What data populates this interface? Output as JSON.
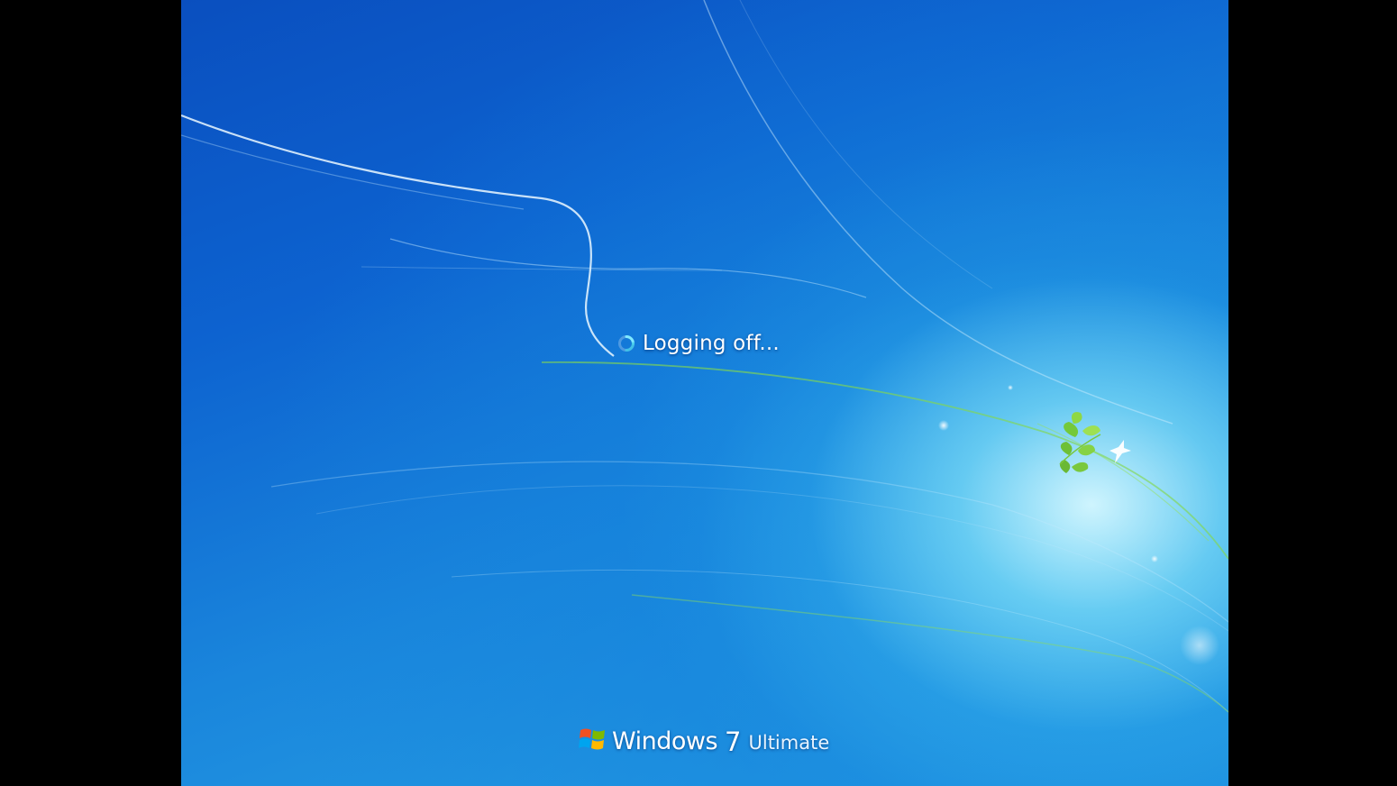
{
  "status": {
    "message": "Logging off...",
    "spinner_icon": "busy-spinner-icon"
  },
  "branding": {
    "product_name": "Windows",
    "version": "7",
    "edition": "Ultimate",
    "logo_icon": "windows-flag-icon"
  },
  "colors": {
    "background_deep": "#0a4fbf",
    "background_light": "#2aa6e6",
    "glow": "#d7f8ff",
    "leaf_green": "#7ed43a",
    "text": "#ffffff"
  }
}
